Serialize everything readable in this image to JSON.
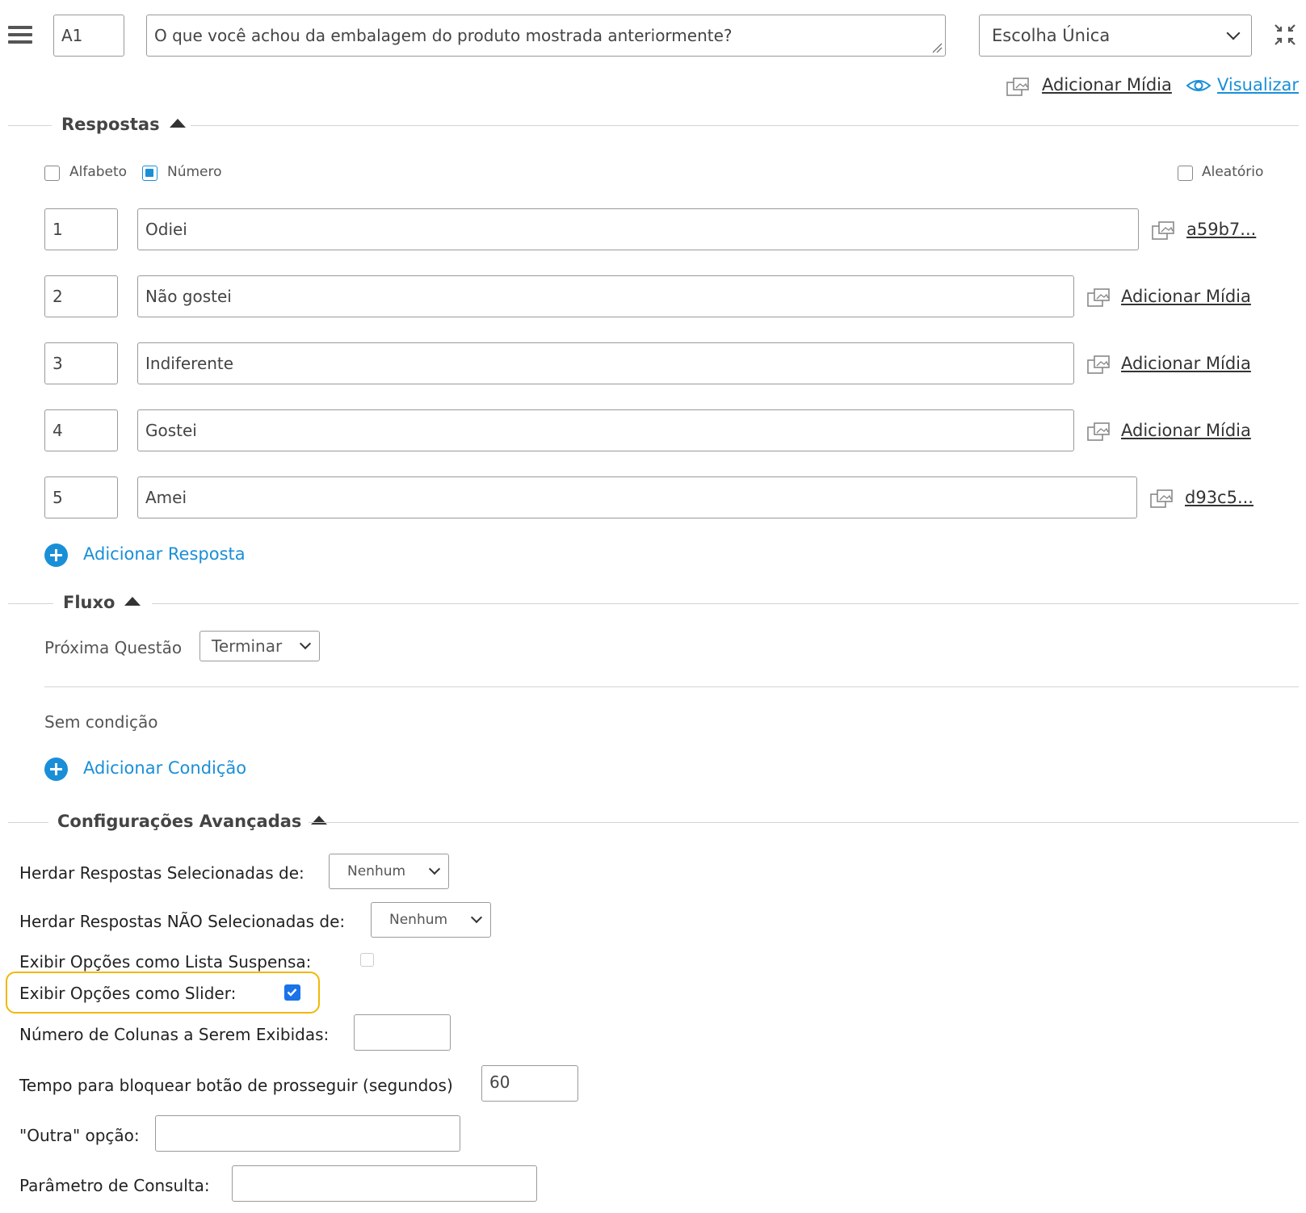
{
  "header": {
    "question_code": "A1",
    "question_text": "O que você achou da embalagem do produto mostrada anteriormente?",
    "question_type": "Escolha Única",
    "add_media": "Adicionar Mídia",
    "preview": "Visualizar"
  },
  "respostas": {
    "title": "Respostas",
    "alfabeto": "Alfabeto",
    "numero": "Número",
    "aleatorio": "Aleatório",
    "answers": [
      {
        "code": "1",
        "text": "Odiei",
        "media": "a59b7..."
      },
      {
        "code": "2",
        "text": "Não gostei",
        "media": "Adicionar Mídia"
      },
      {
        "code": "3",
        "text": "Indiferente",
        "media": "Adicionar Mídia"
      },
      {
        "code": "4",
        "text": "Gostei",
        "media": "Adicionar Mídia"
      },
      {
        "code": "5",
        "text": "Amei",
        "media": "d93c5..."
      }
    ],
    "add_answer": "Adicionar Resposta"
  },
  "fluxo": {
    "title": "Fluxo",
    "next_label": "Próxima Questão",
    "next_value": "Terminar",
    "no_condition": "Sem condição",
    "add_condition": "Adicionar Condição"
  },
  "advanced": {
    "title": "Configurações Avançadas",
    "inherit_selected_label": "Herdar Respostas Selecionadas de:",
    "inherit_selected_value": "Nenhum",
    "inherit_unselected_label": "Herdar Respostas NÃO Selecionadas de:",
    "inherit_unselected_value": "Nenhum",
    "dropdown_label": "Exibir Opções como Lista Suspensa:",
    "slider_label": "Exibir Opções como Slider:",
    "columns_label": "Número de Colunas a Serem Exibidas:",
    "columns_value": "",
    "lock_label": "Tempo para bloquear botão de prosseguir (segundos)",
    "lock_value": "60",
    "other_label": "\"Outra\" opção:",
    "other_value": "",
    "param_label": "Parâmetro de Consulta:",
    "param_value": ""
  },
  "colors": {
    "accent": "#1a8fd8",
    "highlight": "#f2b705"
  }
}
